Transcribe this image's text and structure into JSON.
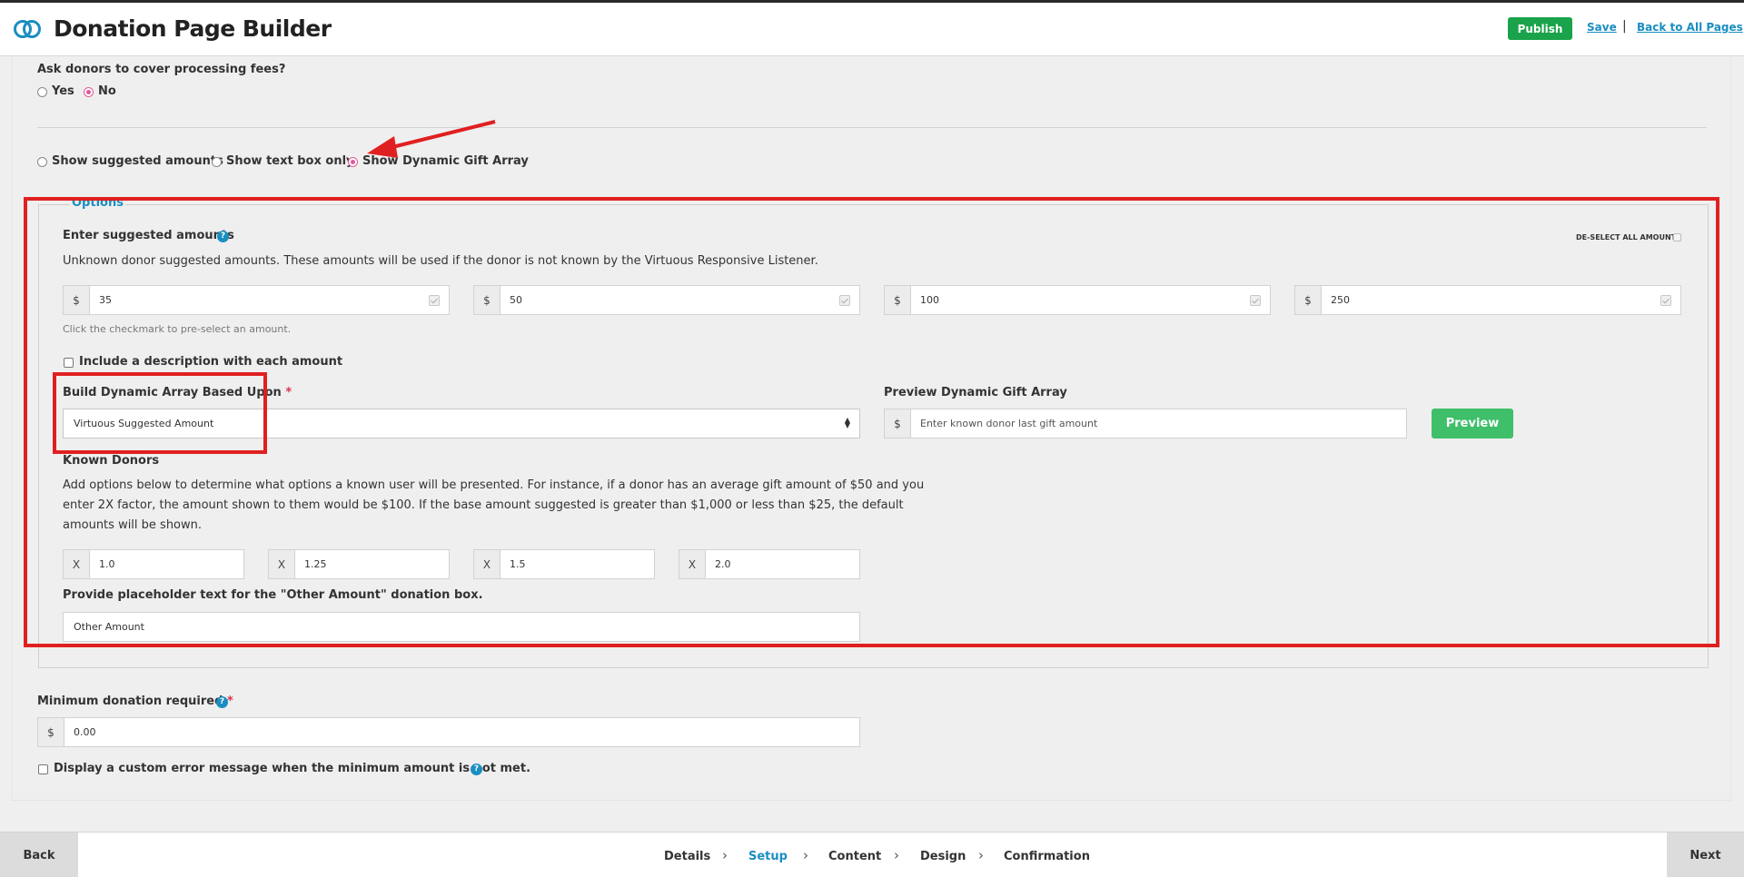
{
  "header": {
    "title": "Donation Page Builder",
    "publish_label": "Publish",
    "save_label": "Save",
    "separator": "|",
    "back_to_all_label": "Back to All Pages"
  },
  "processing_fees": {
    "question": "Ask donors to cover processing fees?",
    "options": [
      "Yes",
      "No"
    ],
    "selected": "No"
  },
  "display_mode": {
    "options": [
      "Show suggested amounts",
      "Show text box only",
      "Show Dynamic Gift Array"
    ],
    "selected": "Show Dynamic Gift Array"
  },
  "options_section": {
    "legend": "Options",
    "suggested_heading": "Enter suggested amounts",
    "deselect_label": "DE-SELECT ALL AMOUNTS",
    "unknown_desc": "Unknown donor suggested amounts. These amounts will be used if the donor is not known by the Virtuous Responsive Listener.",
    "currency_symbol": "$",
    "amounts": [
      "35",
      "50",
      "100",
      "250"
    ],
    "checkmark_hint": "Click the checkmark to pre-select an amount.",
    "include_desc_label": "Include a description with each amount",
    "build_array_label": "Build Dynamic Array Based Upon",
    "required_mark": "*",
    "build_array_value": "Virtuous Suggested Amount",
    "preview_label": "Preview Dynamic Gift Array",
    "preview_placeholder": "Enter known donor last gift amount",
    "preview_button": "Preview",
    "known_donors_heading": "Known Donors",
    "known_donors_desc_lines": [
      "Add options below to determine what options a known user will be presented. For instance, if a donor has an average gift amount of $50 and you",
      "enter 2X factor, the amount shown to them would be $100. If the base amount suggested is greater than $1,000 or less than $25, the default",
      "amounts will be shown."
    ],
    "multiplier_symbol": "X",
    "multipliers": [
      "1.0",
      "1.25",
      "1.5",
      "2.0"
    ],
    "placeholder_text_label": "Provide placeholder text for the \"Other Amount\" donation box.",
    "placeholder_text_value": "Other Amount"
  },
  "minimum": {
    "label": "Minimum donation required",
    "required_mark": "*",
    "currency_symbol": "$",
    "value": "0.00",
    "custom_error_label": "Display a custom error message when the minimum amount is not met."
  },
  "footer": {
    "back_label": "Back",
    "next_label": "Next",
    "steps": [
      "Details",
      "Setup",
      "Content",
      "Design",
      "Confirmation"
    ],
    "active_step": "Setup"
  },
  "colors": {
    "accent": "#1a8ec0",
    "publish_green": "#1aa34a",
    "preview_green": "#3fbf6a",
    "radio_selected": "#e05a9a",
    "annotation_red": "#e02020"
  },
  "icons": {
    "logo": "virtuous-logo-icon",
    "help": "question-circle-icon",
    "check": "checkmark-icon",
    "chevron": "chevron-right-icon",
    "select_caret": "caret-up-down-icon"
  }
}
